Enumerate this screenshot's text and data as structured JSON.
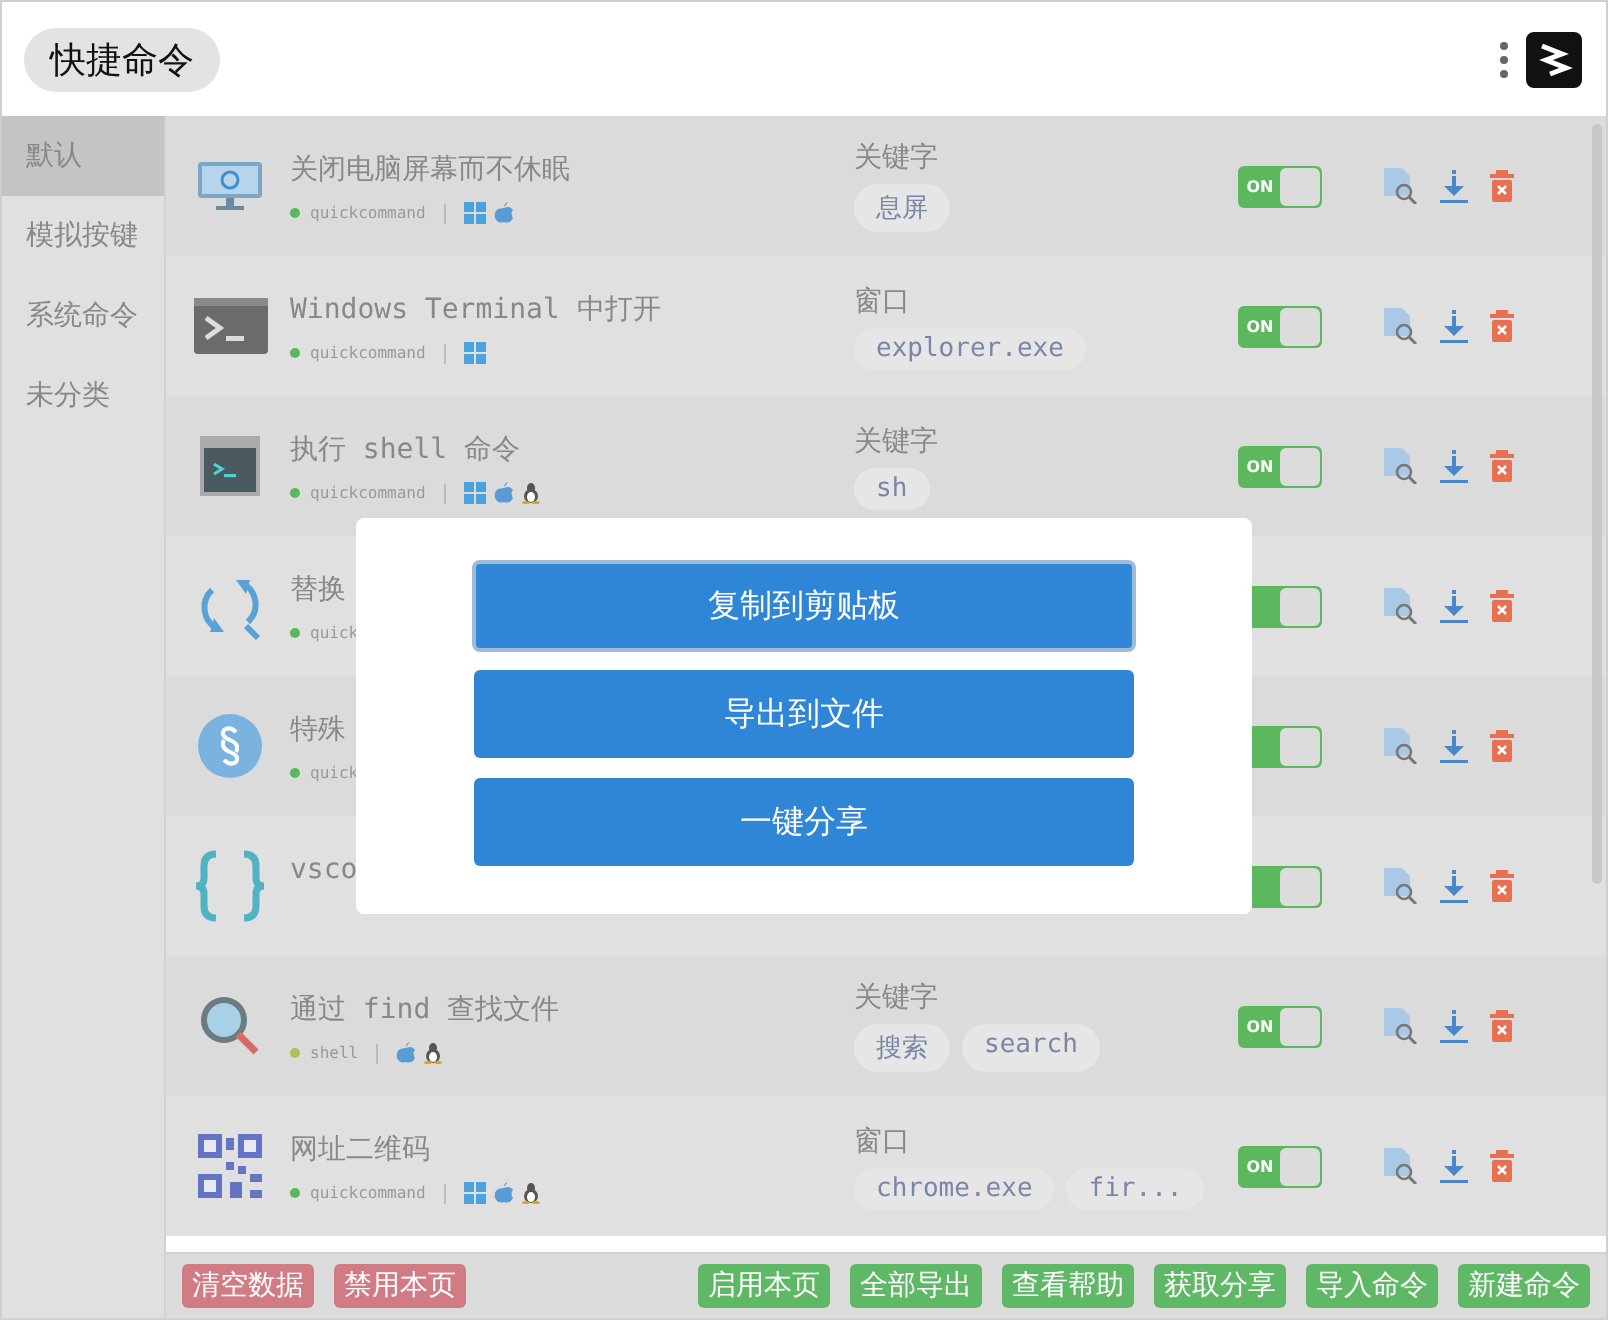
{
  "header": {
    "title": "快捷命令"
  },
  "sidebar": {
    "items": [
      {
        "label": "默认",
        "selected": true
      },
      {
        "label": "模拟按键",
        "selected": false
      },
      {
        "label": "系统命令",
        "selected": false
      },
      {
        "label": "未分类",
        "selected": false
      }
    ]
  },
  "commands": [
    {
      "kind": "monitor",
      "title": "关闭电脑屏幕而不休眠",
      "program": "quickcommand",
      "color": "#5cb85c",
      "platforms": [
        {
          "kind": "win"
        },
        {
          "kind": "mac"
        }
      ],
      "match_type": "关键字",
      "tags": [
        "息屏"
      ],
      "enabled": true,
      "toggle_label": "ON"
    },
    {
      "kind": "terminal",
      "title": "Windows Terminal 中打开",
      "program": "quickcommand",
      "color": "#5cb85c",
      "platforms": [
        {
          "kind": "win"
        }
      ],
      "match_type": "窗口",
      "tags": [
        "explorer.exe"
      ],
      "enabled": true,
      "toggle_label": "ON"
    },
    {
      "kind": "shell",
      "title": "执行 shell 命令",
      "program": "quickcommand",
      "color": "#5cb85c",
      "platforms": [
        {
          "kind": "win"
        },
        {
          "kind": "mac"
        },
        {
          "kind": "linux"
        }
      ],
      "match_type": "关键字",
      "tags": [
        "sh"
      ],
      "enabled": true,
      "toggle_label": "ON"
    },
    {
      "kind": "refresh",
      "title": "替换",
      "program": "quick",
      "color": "#5cb85c",
      "enabled": true
    },
    {
      "kind": "section",
      "title": "特殊",
      "program": "quick",
      "color": "#5cb85c",
      "enabled": true
    },
    {
      "kind": "braces",
      "title": "vsco",
      "enabled": true
    },
    {
      "kind": "search",
      "title": "通过 find 查找文件",
      "program": "shell",
      "color": "#a5c25c",
      "platforms": [
        {
          "kind": "mac"
        },
        {
          "kind": "linux"
        }
      ],
      "match_type": "关键字",
      "tags": [
        "搜索",
        "search"
      ],
      "enabled": true,
      "toggle_label": "ON"
    },
    {
      "kind": "qr",
      "title": "网址二维码",
      "program": "quickcommand",
      "color": "#5cb85c",
      "platforms": [
        {
          "kind": "win"
        },
        {
          "kind": "mac"
        },
        {
          "kind": "linux"
        }
      ],
      "match_type": "窗口",
      "tags": [
        "chrome.exe",
        "fir..."
      ],
      "enabled": true,
      "toggle_label": "ON"
    }
  ],
  "footer": {
    "buttons": [
      {
        "label": "清空数据",
        "kind": "danger"
      },
      {
        "label": "禁用本页",
        "kind": "danger"
      },
      {
        "label": "启用本页",
        "kind": "success"
      },
      {
        "label": "全部导出",
        "kind": "success"
      },
      {
        "label": "查看帮助",
        "kind": "success"
      },
      {
        "label": "获取分享",
        "kind": "success"
      },
      {
        "label": "导入命令",
        "kind": "success"
      },
      {
        "label": "新建命令",
        "kind": "success"
      }
    ]
  },
  "dialog": {
    "buttons": [
      {
        "label": "复制到剪贴板",
        "focused": true
      },
      {
        "label": "导出到文件",
        "focused": false
      },
      {
        "label": "一键分享",
        "focused": false
      }
    ]
  }
}
